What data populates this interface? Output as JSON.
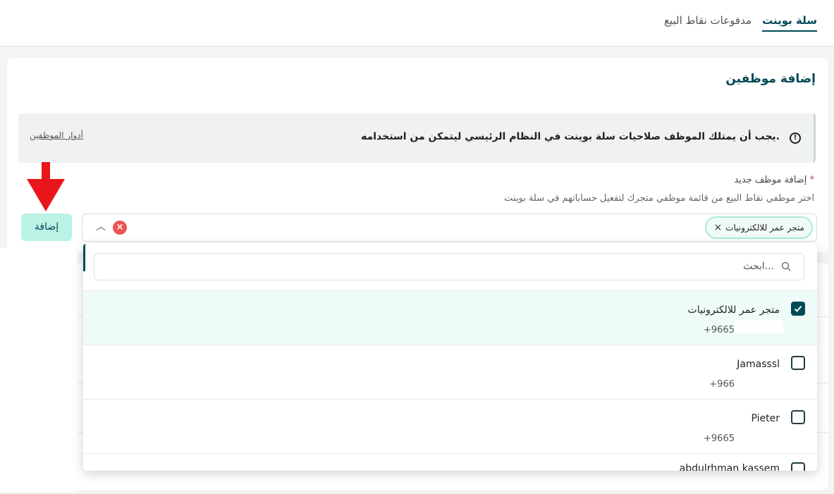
{
  "tabs": [
    {
      "label": "سلة بوينت",
      "active": true
    },
    {
      "label": "مدفوعات نقاط البيع",
      "active": false
    }
  ],
  "card": {
    "title": "إضافة موظفين",
    "alert_text": "يجب أن يمتلك الموظف صلاحيات سلة بوينت في النظام الرئيسي ليتمكن من استخدامه.",
    "alert_link": "أدوار الموظفين",
    "field_label": "إضافة موظف جديد",
    "required_mark": "*",
    "field_help": "اختر موظفي نقاط البيع من قائمة موظفي متجرك لتفعيل حساباتهم في سلة بوينت",
    "selected_chip": "متجر عمر للالكترونيات",
    "add_button_label": "إضافة"
  },
  "dropdown": {
    "search_placeholder": "ابحث...",
    "options": [
      {
        "name": "متجر عمر للالكترونيات",
        "phone": "+9665",
        "checked": true
      },
      {
        "name": "Jamasssl",
        "phone": "+966",
        "checked": false
      },
      {
        "name": "Pieter",
        "phone": "+9665",
        "checked": false
      },
      {
        "name": "abdulrhman kassem",
        "phone": "",
        "checked": false
      }
    ]
  },
  "colors": {
    "primary": "#004956",
    "accent_mint": "#baf3e6",
    "selected_row": "#effbf8",
    "arrow": "#e8161b",
    "clear": "#ea5455"
  }
}
